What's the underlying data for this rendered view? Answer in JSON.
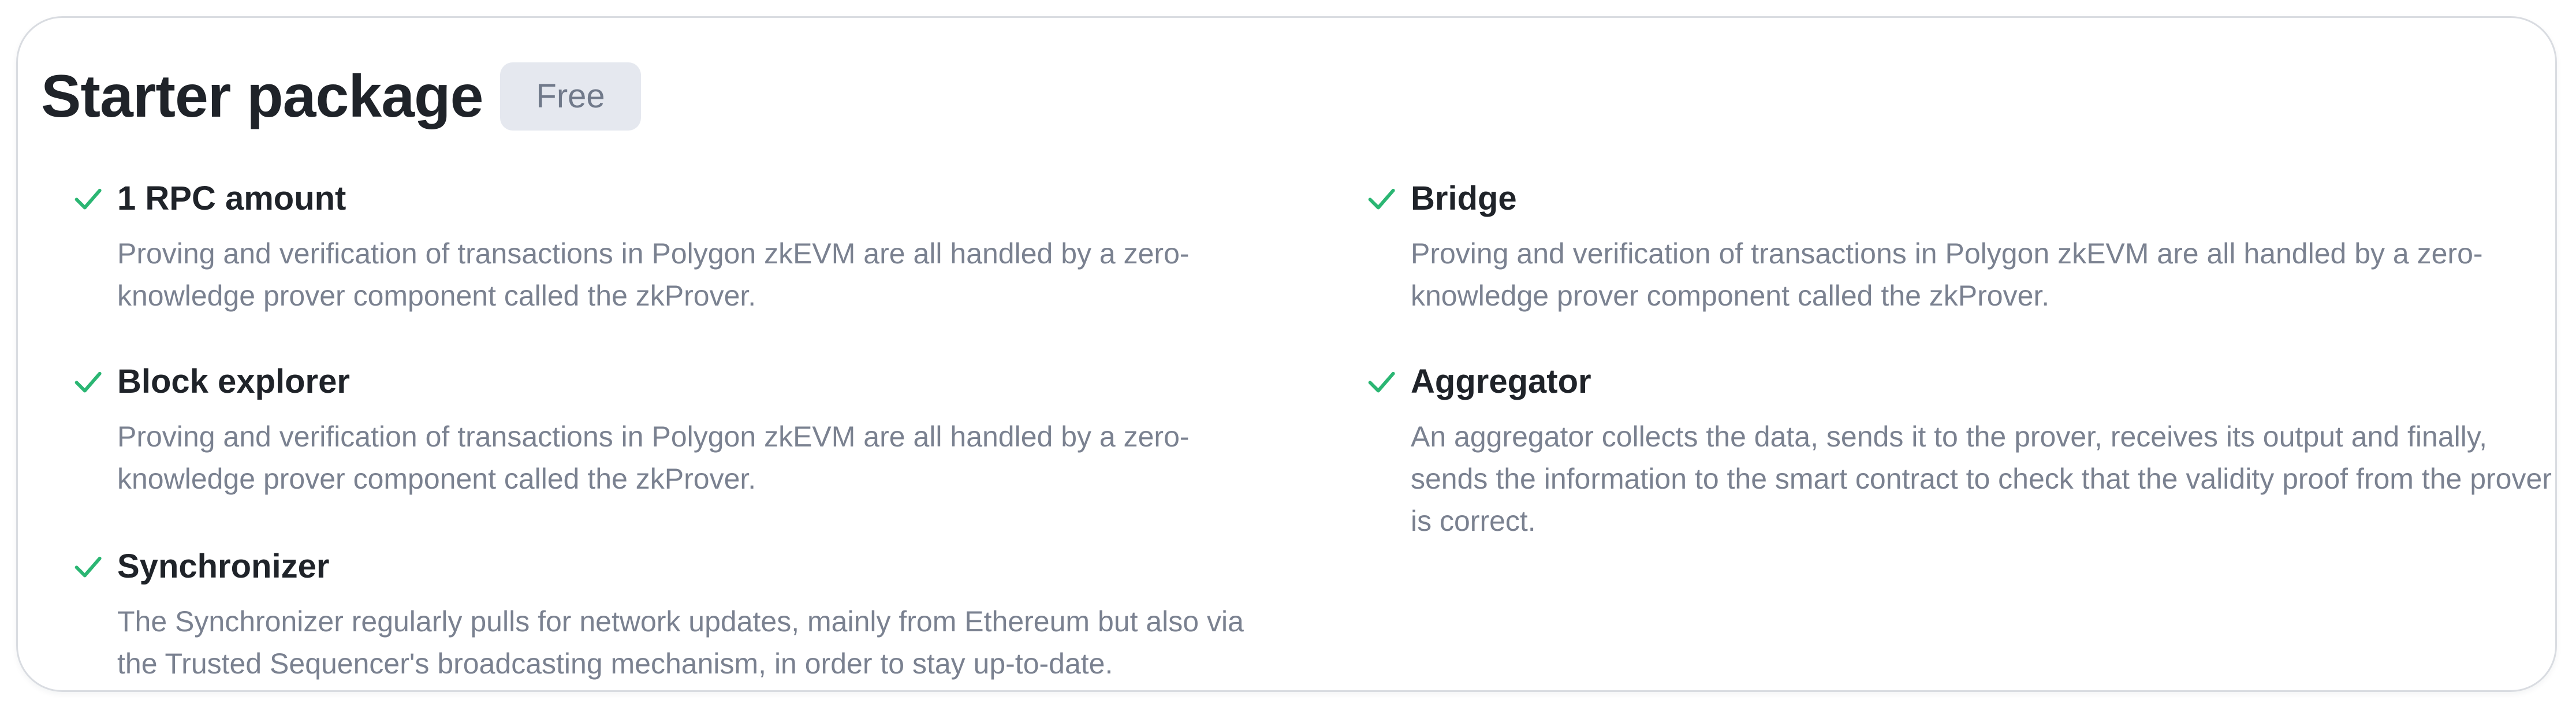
{
  "package": {
    "title": "Starter package",
    "badge": "Free"
  },
  "features": [
    {
      "title": "1 RPC amount",
      "description": "Proving and verification of transactions in Polygon zkEVM are all handled by a zero-knowledge prover component called the zkProver."
    },
    {
      "title": "Block explorer",
      "description": "Proving and verification of transactions in Polygon zkEVM are all handled by a zero-knowledge prover component called the zkProver."
    },
    {
      "title": "Synchronizer",
      "description": "The Synchronizer regularly pulls for network updates, mainly from Ethereum but also via the Trusted Sequencer's broadcasting mechanism, in order to stay up-to-date."
    },
    {
      "title": "Bridge",
      "description": "Proving and verification of transactions in Polygon zkEVM are all handled by a zero-knowledge prover component called the zkProver."
    },
    {
      "title": "Aggregator",
      "description": "An aggregator collects the data, sends it to the prover, receives its output and finally, sends the information to the smart contract to check that the validity proof from the prover is correct."
    }
  ],
  "icons": {
    "feature_icon": "check-icon"
  },
  "colors": {
    "check": "#2bb673",
    "title_text": "#1f2329",
    "description_text": "#7a8190",
    "badge_background": "#e5e8ef",
    "badge_text": "#70798a",
    "card_border": "#d9dce1"
  }
}
